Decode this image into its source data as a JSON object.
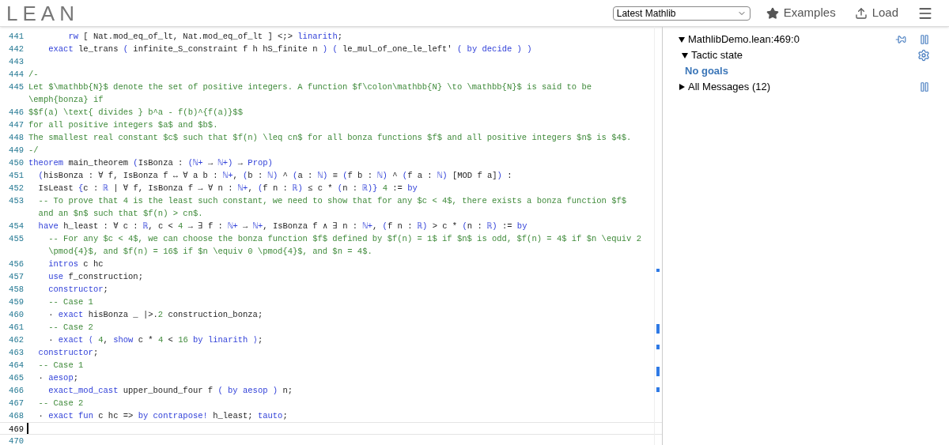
{
  "header": {
    "logo": "LEAN",
    "project_select": {
      "value": "Latest Mathlib"
    },
    "nav": [
      {
        "label": "Examples",
        "kind": "star"
      },
      {
        "label": "Load",
        "kind": "upload"
      }
    ]
  },
  "editor": {
    "lines": [
      {
        "number": "441",
        "selected": false,
        "rows": [
          [
            {
              "kind": "p",
              "text": "        "
            },
            {
              "kind": "kw",
              "text": "rw"
            },
            {
              "kind": "p",
              "text": " [ Nat.mod_eq_of_lt, Nat.mod_eq_of_lt ] <;> "
            },
            {
              "kind": "kw",
              "text": "linarith"
            },
            {
              "kind": "p",
              "text": ";"
            }
          ]
        ]
      },
      {
        "number": "442",
        "selected": false,
        "rows": [
          [
            {
              "kind": "p",
              "text": "    "
            },
            {
              "kind": "kw",
              "text": "exact"
            },
            {
              "kind": "p",
              "text": " le_trans "
            },
            {
              "kind": "kw",
              "text": "("
            },
            {
              "kind": "p",
              "text": " infinite_S_constraint f h hS_finite n "
            },
            {
              "kind": "kw",
              "text": ")"
            },
            {
              "kind": "p",
              "text": " "
            },
            {
              "kind": "kw",
              "text": "("
            },
            {
              "kind": "p",
              "text": " le_mul_of_one_le_left' "
            },
            {
              "kind": "kw",
              "text": "( by decide ) )"
            }
          ]
        ]
      },
      {
        "number": "443",
        "selected": false
      },
      {
        "number": "444",
        "selected": false,
        "rows": [
          [
            {
              "kind": "cm",
              "text": "/-"
            }
          ]
        ]
      },
      {
        "number": "445",
        "selected": false,
        "rows": [
          [
            {
              "kind": "cm",
              "text": "Let $\\mathbb{N}$ denote the set of positive integers. A function $f\\colon\\mathbb{N} \\to \\mathbb{N}$ is said to be"
            }
          ],
          [
            {
              "kind": "cm",
              "text": "\\emph{bonza} if"
            }
          ]
        ]
      },
      {
        "number": "446",
        "selected": false,
        "rows": [
          [
            {
              "kind": "cm",
              "text": "$$f(a) \\text{ divides } b^a - f(b)^{f(a)}$$"
            }
          ]
        ]
      },
      {
        "number": "447",
        "selected": false,
        "rows": [
          [
            {
              "kind": "cm",
              "text": "for all positive integers $a$ and $b$."
            }
          ]
        ]
      },
      {
        "number": "448",
        "selected": false,
        "rows": [
          [
            {
              "kind": "cm",
              "text": "The smallest real constant $c$ such that $f(n) \\leq cn$ for all bonza functions $f$ and all positive integers $n$ is $4$."
            }
          ]
        ]
      },
      {
        "number": "449",
        "selected": false,
        "rows": [
          [
            {
              "kind": "cm",
              "text": "-/"
            }
          ]
        ]
      },
      {
        "number": "450",
        "selected": false,
        "rows": [
          [
            {
              "kind": "kw",
              "text": "theorem"
            },
            {
              "kind": "p",
              "text": " main_theorem "
            },
            {
              "kind": "kw",
              "text": "("
            },
            {
              "kind": "p",
              "text": "IsBonza : "
            },
            {
              "kind": "kw",
              "text": "(ℕ+"
            },
            {
              "kind": "p",
              "text": " → "
            },
            {
              "kind": "kw",
              "text": "ℕ+)"
            },
            {
              "kind": "p",
              "text": " → "
            },
            {
              "kind": "kw",
              "text": "Prop)"
            }
          ]
        ]
      },
      {
        "number": "451",
        "selected": false,
        "rows": [
          [
            {
              "kind": "p",
              "text": "  "
            },
            {
              "kind": "kw",
              "text": "("
            },
            {
              "kind": "p",
              "text": "hisBonza : ∀ f, IsBonza f ↔ ∀ a b : "
            },
            {
              "kind": "kw",
              "text": "ℕ+"
            },
            {
              "kind": "p",
              "text": ", "
            },
            {
              "kind": "kw",
              "text": "("
            },
            {
              "kind": "p",
              "text": "b : "
            },
            {
              "kind": "kw",
              "text": "ℕ)"
            },
            {
              "kind": "p",
              "text": " ^ "
            },
            {
              "kind": "kw",
              "text": "("
            },
            {
              "kind": "p",
              "text": "a : "
            },
            {
              "kind": "kw",
              "text": "ℕ)"
            },
            {
              "kind": "p",
              "text": " ≡ "
            },
            {
              "kind": "kw",
              "text": "("
            },
            {
              "kind": "p",
              "text": "f b : "
            },
            {
              "kind": "kw",
              "text": "ℕ)"
            },
            {
              "kind": "p",
              "text": " ^ "
            },
            {
              "kind": "kw",
              "text": "("
            },
            {
              "kind": "p",
              "text": "f a : "
            },
            {
              "kind": "kw",
              "text": "ℕ)"
            },
            {
              "kind": "p",
              "text": " [MOD f a]"
            },
            {
              "kind": "kw",
              "text": ")"
            },
            {
              "kind": "p",
              "text": " :"
            }
          ]
        ]
      },
      {
        "number": "452",
        "selected": false,
        "rows": [
          [
            {
              "kind": "p",
              "text": "  IsLeast "
            },
            {
              "kind": "kw",
              "text": "{"
            },
            {
              "kind": "p",
              "text": "c : "
            },
            {
              "kind": "kw",
              "text": "ℝ"
            },
            {
              "kind": "p",
              "text": " | ∀ f, IsBonza f → ∀ n : "
            },
            {
              "kind": "kw",
              "text": "ℕ+"
            },
            {
              "kind": "p",
              "text": ", "
            },
            {
              "kind": "kw",
              "text": "("
            },
            {
              "kind": "p",
              "text": "f n : "
            },
            {
              "kind": "kw",
              "text": "ℝ)"
            },
            {
              "kind": "p",
              "text": " ≤ c * "
            },
            {
              "kind": "kw",
              "text": "("
            },
            {
              "kind": "p",
              "text": "n : "
            },
            {
              "kind": "kw",
              "text": "ℝ)}"
            },
            {
              "kind": "p",
              "text": " "
            },
            {
              "kind": "num",
              "text": "4"
            },
            {
              "kind": "p",
              "text": " := "
            },
            {
              "kind": "kw",
              "text": "by"
            }
          ]
        ]
      },
      {
        "number": "453",
        "selected": false,
        "rows": [
          [
            {
              "kind": "cm",
              "text": "  -- To prove that 4 is the least such constant, we need to show that for any $c < 4$, there exists a bonza function $f$"
            }
          ],
          [
            {
              "kind": "cm",
              "text": "  and an $n$ such that $f(n) > cn$."
            }
          ]
        ]
      },
      {
        "number": "454",
        "selected": false,
        "rows": [
          [
            {
              "kind": "p",
              "text": "  "
            },
            {
              "kind": "kw",
              "text": "have"
            },
            {
              "kind": "p",
              "text": " h_least : ∀ c : "
            },
            {
              "kind": "kw",
              "text": "ℝ"
            },
            {
              "kind": "p",
              "text": ", c < "
            },
            {
              "kind": "num",
              "text": "4"
            },
            {
              "kind": "p",
              "text": " → ∃ f : "
            },
            {
              "kind": "kw",
              "text": "ℕ+"
            },
            {
              "kind": "p",
              "text": " → "
            },
            {
              "kind": "kw",
              "text": "ℕ+"
            },
            {
              "kind": "p",
              "text": ", IsBonza f ∧ ∃ n : "
            },
            {
              "kind": "kw",
              "text": "ℕ+"
            },
            {
              "kind": "p",
              "text": ", "
            },
            {
              "kind": "kw",
              "text": "("
            },
            {
              "kind": "p",
              "text": "f n : "
            },
            {
              "kind": "kw",
              "text": "ℝ)"
            },
            {
              "kind": "p",
              "text": " > c * "
            },
            {
              "kind": "kw",
              "text": "("
            },
            {
              "kind": "p",
              "text": "n : "
            },
            {
              "kind": "kw",
              "text": "ℝ)"
            },
            {
              "kind": "p",
              "text": " := "
            },
            {
              "kind": "kw",
              "text": "by"
            }
          ]
        ]
      },
      {
        "number": "455",
        "selected": false,
        "rows": [
          [
            {
              "kind": "cm",
              "text": "    -- For any $c < 4$, we can choose the bonza function $f$ defined by $f(n) = 1$ if $n$ is odd, $f(n) = 4$ if $n \\equiv 2"
            }
          ],
          [
            {
              "kind": "cm",
              "text": "    \\pmod{4}$, and $f(n) = 16$ if $n \\equiv 0 \\pmod{4}$, and $n = 4$."
            }
          ]
        ]
      },
      {
        "number": "456",
        "selected": false,
        "rows": [
          [
            {
              "kind": "p",
              "text": "    "
            },
            {
              "kind": "kw",
              "text": "intros"
            },
            {
              "kind": "p",
              "text": " c hc"
            }
          ]
        ]
      },
      {
        "number": "457",
        "selected": false,
        "rows": [
          [
            {
              "kind": "p",
              "text": "    "
            },
            {
              "kind": "kw",
              "text": "use"
            },
            {
              "kind": "p",
              "text": " f_construction;"
            }
          ]
        ]
      },
      {
        "number": "458",
        "selected": false,
        "rows": [
          [
            {
              "kind": "p",
              "text": "    "
            },
            {
              "kind": "kw",
              "text": "constructor"
            },
            {
              "kind": "p",
              "text": ";"
            }
          ]
        ]
      },
      {
        "number": "459",
        "selected": false,
        "rows": [
          [
            {
              "kind": "cm",
              "text": "    -- Case 1"
            }
          ]
        ]
      },
      {
        "number": "460",
        "selected": false,
        "rows": [
          [
            {
              "kind": "p",
              "text": "    · "
            },
            {
              "kind": "kw",
              "text": "exact"
            },
            {
              "kind": "p",
              "text": " hisBonza _ |>."
            },
            {
              "kind": "num",
              "text": "2"
            },
            {
              "kind": "p",
              "text": " construction_bonza;"
            }
          ]
        ]
      },
      {
        "number": "461",
        "selected": false,
        "rows": [
          [
            {
              "kind": "cm",
              "text": "    -- Case 2"
            }
          ]
        ]
      },
      {
        "number": "462",
        "selected": false,
        "rows": [
          [
            {
              "kind": "p",
              "text": "    · "
            },
            {
              "kind": "kw",
              "text": "exact ⟨"
            },
            {
              "kind": "p",
              "text": " "
            },
            {
              "kind": "num",
              "text": "4"
            },
            {
              "kind": "p",
              "text": ", "
            },
            {
              "kind": "kw",
              "text": "show"
            },
            {
              "kind": "p",
              "text": " c * "
            },
            {
              "kind": "num",
              "text": "4"
            },
            {
              "kind": "p",
              "text": " < "
            },
            {
              "kind": "num",
              "text": "16"
            },
            {
              "kind": "p",
              "text": " "
            },
            {
              "kind": "kw",
              "text": "by linarith ⟩"
            },
            {
              "kind": "p",
              "text": ";"
            }
          ]
        ]
      },
      {
        "number": "463",
        "selected": false,
        "rows": [
          [
            {
              "kind": "p",
              "text": "  "
            },
            {
              "kind": "kw",
              "text": "constructor"
            },
            {
              "kind": "p",
              "text": ";"
            }
          ]
        ]
      },
      {
        "number": "464",
        "selected": false,
        "rows": [
          [
            {
              "kind": "cm",
              "text": "  -- Case 1"
            }
          ]
        ]
      },
      {
        "number": "465",
        "selected": false,
        "rows": [
          [
            {
              "kind": "p",
              "text": "  · "
            },
            {
              "kind": "kw",
              "text": "aesop"
            },
            {
              "kind": "p",
              "text": ";"
            }
          ]
        ]
      },
      {
        "number": "466",
        "selected": false,
        "rows": [
          [
            {
              "kind": "p",
              "text": "    "
            },
            {
              "kind": "kw",
              "text": "exact_mod_cast"
            },
            {
              "kind": "p",
              "text": " upper_bound_four f "
            },
            {
              "kind": "kw",
              "text": "( by aesop )"
            },
            {
              "kind": "p",
              "text": " n;"
            }
          ]
        ]
      },
      {
        "number": "467",
        "selected": false,
        "rows": [
          [
            {
              "kind": "cm",
              "text": "  -- Case 2"
            }
          ]
        ]
      },
      {
        "number": "468",
        "selected": false,
        "rows": [
          [
            {
              "kind": "p",
              "text": "  · "
            },
            {
              "kind": "kw",
              "text": "exact fun"
            },
            {
              "kind": "p",
              "text": " c hc => "
            },
            {
              "kind": "kw",
              "text": "by contrapose!"
            },
            {
              "kind": "p",
              "text": " h_least; "
            },
            {
              "kind": "kw",
              "text": "tauto"
            },
            {
              "kind": "p",
              "text": ";"
            }
          ]
        ]
      },
      {
        "number": "469",
        "selected": true
      },
      {
        "number": "470",
        "selected": false
      }
    ]
  },
  "infoview": {
    "location": {
      "label": "MathlibDemo.lean:469:0",
      "expanded": true
    },
    "tactic_state": {
      "label": "Tactic state",
      "expanded": true,
      "goals": "No goals"
    },
    "messages": {
      "label": "All Messages (12)",
      "expanded": false
    }
  }
}
